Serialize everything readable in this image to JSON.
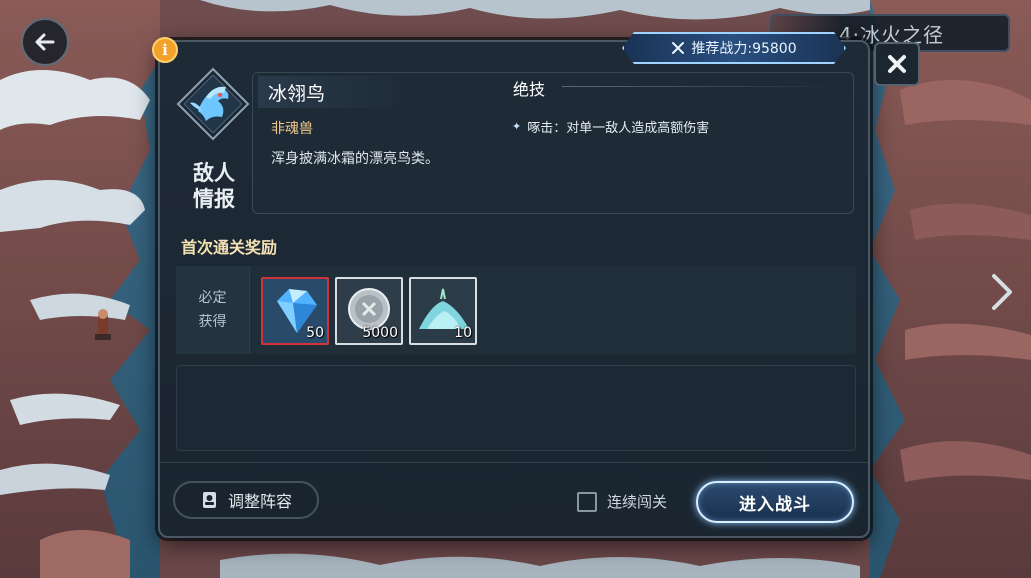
{
  "stage": {
    "title": "4·冰火之径"
  },
  "power": {
    "label": "推荐战力:95800"
  },
  "enemy": {
    "section_label": "敌人情报",
    "name": "冰翎鸟",
    "type": "非魂兽",
    "description": "浑身披满冰霜的漂亮鸟类。"
  },
  "skill": {
    "title": "绝技",
    "items": [
      {
        "text": "啄击：对单一敌人造成高额伤害"
      }
    ]
  },
  "rewards": {
    "title": "首次通关奖励",
    "row_label": "必定获得",
    "items": [
      {
        "icon": "diamond-icon",
        "count": "50",
        "rarity": "rare"
      },
      {
        "icon": "silver-coin-icon",
        "count": "5000",
        "rarity": "normal"
      },
      {
        "icon": "ice-crystal-pile-icon",
        "count": "10",
        "rarity": "normal"
      }
    ]
  },
  "buttons": {
    "adjust_lineup": "调整阵容",
    "continuous_label": "连续闯关",
    "enter_battle": "进入战斗"
  },
  "colors": {
    "panel_bg": "#1e2a36",
    "accent_blue": "#9fd4ff",
    "reward_title": "#f3e1b3",
    "enemy_type": "#f2c98a",
    "rare_border": "#d0343a",
    "info_badge": "#f2a22b"
  }
}
